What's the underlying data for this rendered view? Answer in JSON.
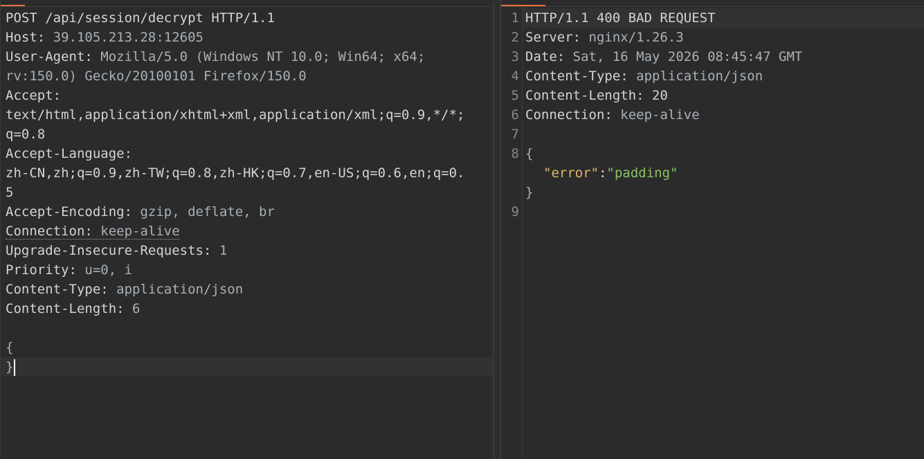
{
  "request": {
    "lines": [
      {
        "key": "POST /api/session/decrypt HTTP/1.1",
        "value": ""
      },
      {
        "key": "Host: ",
        "value": "39.105.213.28:12605"
      },
      {
        "key": "User-Agent: ",
        "value": "Mozilla/5.0 (Windows NT 10.0; Win64; x64;"
      },
      {
        "key": "",
        "value": "rv:150.0) Gecko/20100101 Firefox/150.0"
      },
      {
        "key": "Accept:",
        "value": ""
      },
      {
        "key": "",
        "value": "text/html,application/xhtml+xml,application/xml;q=0.9,*/*;"
      },
      {
        "key": "",
        "value": "q=0.8"
      },
      {
        "key": "Accept-Language:",
        "value": ""
      },
      {
        "key": "",
        "value": "zh-CN,zh;q=0.9,zh-TW;q=0.8,zh-HK;q=0.7,en-US;q=0.6,en;q=0."
      },
      {
        "key": "",
        "value": "5"
      },
      {
        "key": "Accept-Encoding: ",
        "value": "gzip, deflate, br"
      },
      {
        "key": "Connection: ",
        "value": "keep-alive"
      },
      {
        "key": "Upgrade-Insecure-Requests: ",
        "value": "1"
      },
      {
        "key": "Priority: ",
        "value": "u=0, i"
      },
      {
        "key": "Content-Type: ",
        "value": "application/json"
      },
      {
        "key": "Content-Length: ",
        "value": "6"
      },
      {
        "key": "",
        "value": ""
      },
      {
        "key": "",
        "value": "{"
      },
      {
        "key": "",
        "value": "}"
      }
    ]
  },
  "response": {
    "lines": [
      {
        "num": "1",
        "key": "HTTP/1.1 400 BAD REQUEST",
        "value": ""
      },
      {
        "num": "2",
        "key": "Server: ",
        "value": "nginx/1.26.3"
      },
      {
        "num": "3",
        "key": "Date: ",
        "value": "Sat, 16 May 2026 08:45:47 GMT"
      },
      {
        "num": "4",
        "key": "Content-Type: ",
        "value": "application/json"
      },
      {
        "num": "5",
        "key": "Content-Length: ",
        "value": "20"
      },
      {
        "num": "6",
        "key": "Connection: ",
        "value": "keep-alive"
      },
      {
        "num": "7",
        "key": "",
        "value": ""
      },
      {
        "num": "8",
        "key": "",
        "value": "{"
      },
      {
        "num": "",
        "key": "",
        "value": ""
      },
      {
        "num": "",
        "key": "",
        "value": "}"
      },
      {
        "num": "9",
        "key": "",
        "value": ""
      }
    ],
    "json_key": "\"error\"",
    "json_colon": ":",
    "json_value": "\"padding\""
  },
  "colors": {
    "accent": "#e8703a",
    "background": "#2b2b2b",
    "json_key": "#e2b86b",
    "json_string": "#8cc265"
  }
}
